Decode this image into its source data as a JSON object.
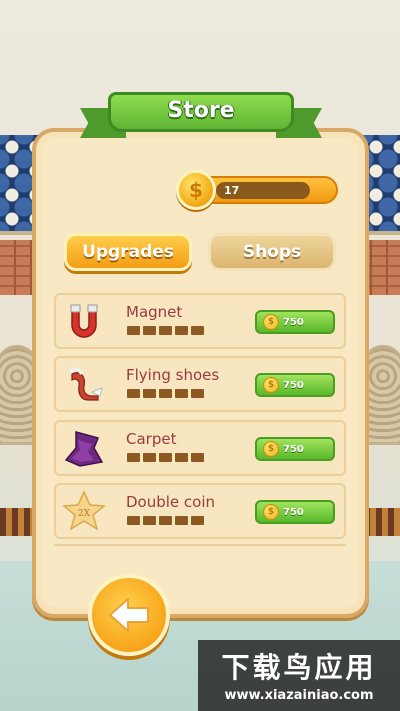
{
  "header": {
    "title": "Store"
  },
  "wallet": {
    "coins": "17",
    "coin_symbol": "$"
  },
  "tabs": [
    {
      "label": "Upgrades",
      "active": true
    },
    {
      "label": "Shops",
      "active": false
    }
  ],
  "items": [
    {
      "name": "Magnet",
      "icon": "magnet-icon",
      "level": 0,
      "max_level": 5,
      "price": "750"
    },
    {
      "name": "Flying shoes",
      "icon": "flying-shoes-icon",
      "level": 0,
      "max_level": 5,
      "price": "750"
    },
    {
      "name": "Carpet",
      "icon": "carpet-icon",
      "level": 0,
      "max_level": 5,
      "price": "750"
    },
    {
      "name": "Double coin",
      "icon": "double-coin-star-icon",
      "icon_text": "2X",
      "level": 0,
      "max_level": 5,
      "price": "750"
    }
  ],
  "price_coin_symbol": "$",
  "back_button": {
    "icon": "back-arrow-icon"
  },
  "watermark": {
    "line1": "下载鸟应用",
    "line2": "www.xiazainiao.com"
  },
  "colors": {
    "ribbon_green": "#5fb534",
    "accent_orange": "#f39d16",
    "panel": "#f6e3b9",
    "item_name": "#9b3b3b",
    "buy_green": "#59b82b"
  }
}
